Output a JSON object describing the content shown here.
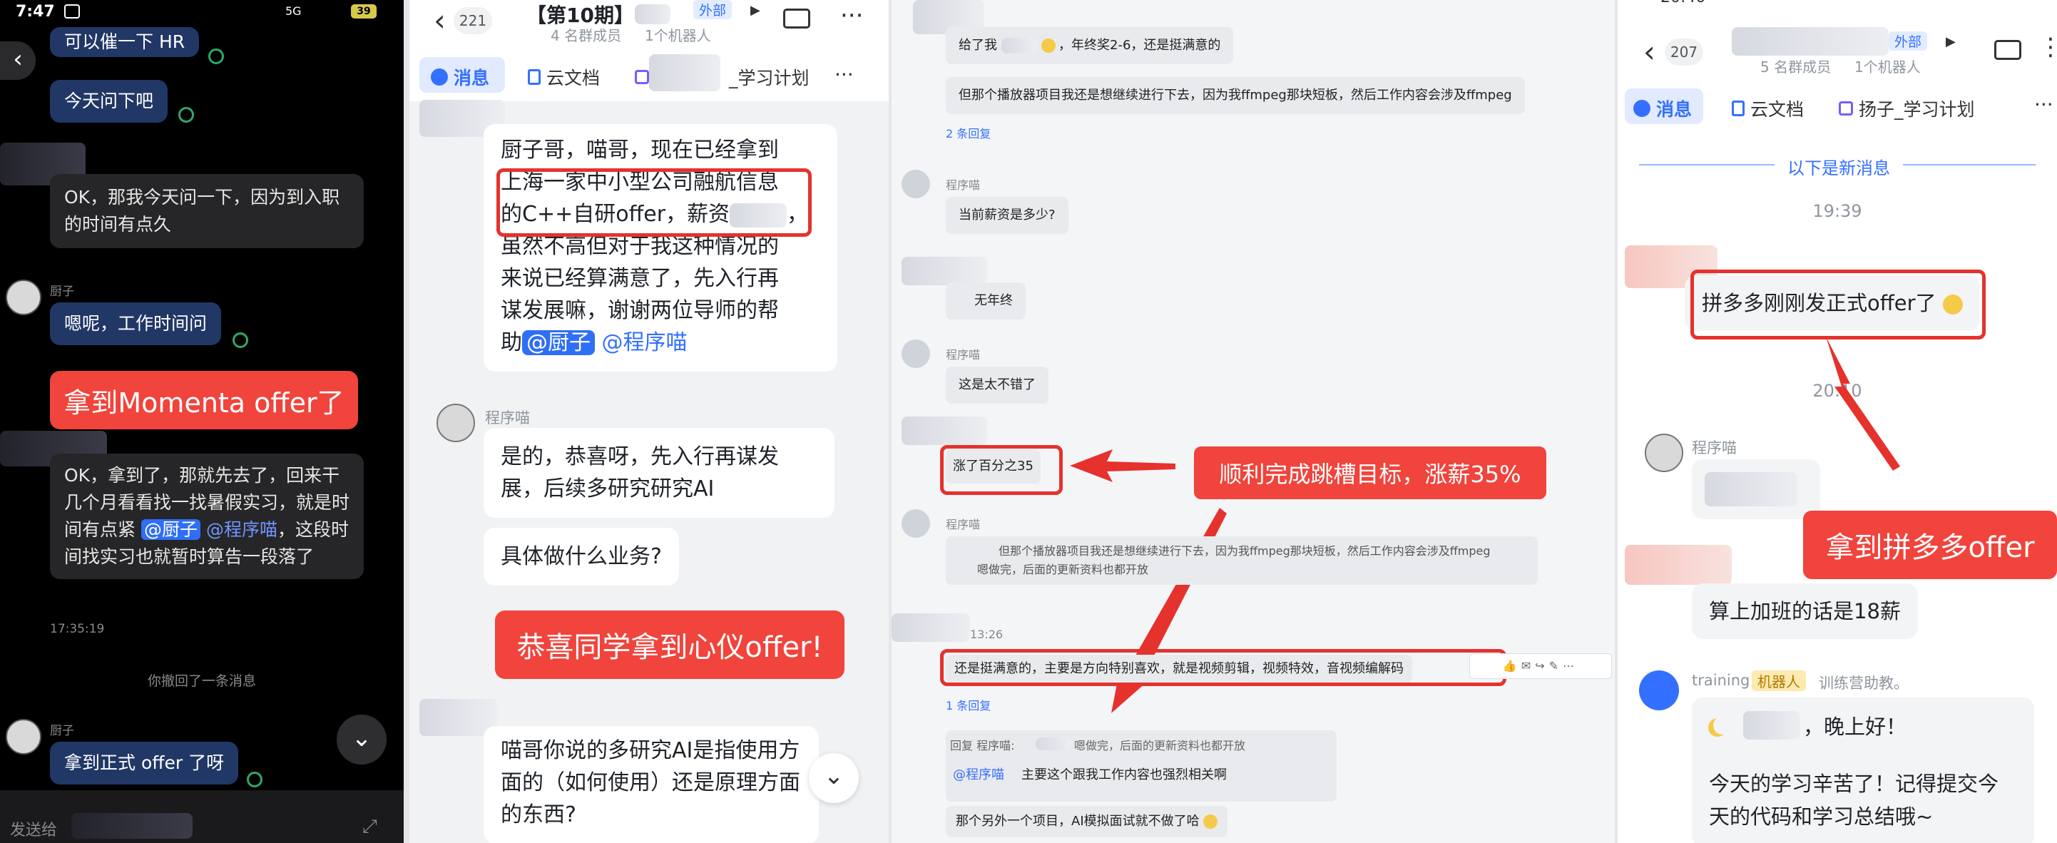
{
  "colors": {
    "accent_blue": "#3370ff",
    "highlight_red": "#e5322d",
    "dark_bubble": "#213766",
    "banner_red": "#f0443c"
  },
  "panel1": {
    "status_time": "7:47",
    "status_net": "5G",
    "battery": "39",
    "msg_top": "可以催一下 HR",
    "msg_today": "今天问下吧",
    "msg_ok_ask": "OK，那我今天问一下，因为到入职的时间有点久",
    "sender1": "厨子",
    "msg_hmm": "嗯呢，工作时间问",
    "banner": "拿到Momenta offer了",
    "msg_long_1": "OK，拿到了，那就先去了，回来干几个月看看找一找暑假实习，就是时间有点紧",
    "mention_a": "@厨子",
    "mention_b": "@程序喵",
    "msg_long_2": "，这段时间找实习也就暂时算告一段落了",
    "timestamp": "17:35:19",
    "recall_notice": "你撤回了一条消息",
    "sender2": "厨子",
    "msg_offer": "拿到正式 offer 了呀",
    "input_placeholder": "发送给"
  },
  "panel2": {
    "back_count": "221",
    "title": "【第10期】",
    "external_badge": "外部",
    "members": "4 名群成员",
    "robots": "1个机器人",
    "tab_msg": "消息",
    "tab_doc": "云文档",
    "tab_plan": "_学习计划",
    "msg1_a": "厨子哥，喵哥，现在已经拿到",
    "msg1_b": "上海一家中小型公司融航信息",
    "msg1_c": "的C++自研offer，薪资",
    "msg1_d": "，",
    "msg1_e": "虽然不高但对于我这种情况的",
    "msg1_f": "来说已经算满意了，先入行再",
    "msg1_g": "谋发展嘛，谢谢两位导师的帮",
    "msg1_h": "助",
    "mention1": "@厨子",
    "mention2": "@程序喵",
    "sender": "程序喵",
    "reply1": "是的，恭喜呀，先入行再谋发展，后续多研究研究AI",
    "reply2": "具体做什么业务?",
    "banner": "恭喜同学拿到心仪offer!",
    "msg2": "喵哥你说的多研究AI是指使用方面的（如何使用）还是原理方面的东西?"
  },
  "panel3": {
    "m1": "给了我",
    "m1_b": "，年终奖2-6，还是挺满意的",
    "m2": "但那个播放器项目我还是想继续进行下去，因为我ffmpeg那块短板，然后工作内容会涉及ffmpeg",
    "replies1": "2 条回复",
    "sender_a": "程序喵",
    "q_salary": "当前薪资是多少?",
    "no_bonus": "无年终",
    "sender_b": "程序喵",
    "good": "这是太不错了",
    "raise": "涨了百分之35",
    "banner": "顺利完成跳槽目标，涨薪35%",
    "sender_c": "程序喵",
    "quote1": "但那个播放器项目我还是想继续进行下去，因为我ffmpeg那块短板，然后工作内容会涉及ffmpeg",
    "quote2": "嗯做完，后面的更新资料也都开放",
    "time": "13:26",
    "satisfied": "还是挺满意的，主要是方向特别喜欢，就是视频剪辑，视频特效，音视频编解码",
    "replies2": "1 条回复",
    "reply_prefix": "回复 程序喵:",
    "reply_quote": "嗯做完，后面的更新资料也都开放",
    "reply_mention": "@程序喵",
    "reply_text": "主要这个跟我工作内容也强烈相关啊",
    "last": "那个另外一个项目，AI模拟面试就不做了哈"
  },
  "panel4": {
    "status_time": "20:40",
    "back_count": "207",
    "external_badge": "外部",
    "members": "5 名群成员",
    "robots": "1个机器人",
    "tab_msg": "消息",
    "tab_doc": "云文档",
    "tab_plan": "扬子_学习计划",
    "new_divider": "以下是新消息",
    "time1": "19:39",
    "msg_pdd": "拼多多刚刚发正式offer了",
    "time2": "20:10",
    "sender": "程序喵",
    "banner": "拿到拼多多offer",
    "msg_overtime": "算上加班的话是18薪",
    "bot_name": "training",
    "bot_badge": "机器人",
    "bot_desc": "训练营助教。",
    "bot_greet": "，晚上好！",
    "bot_msg": "今天的学习辛苦了！记得提交今天的代码和学习总结哦~"
  }
}
